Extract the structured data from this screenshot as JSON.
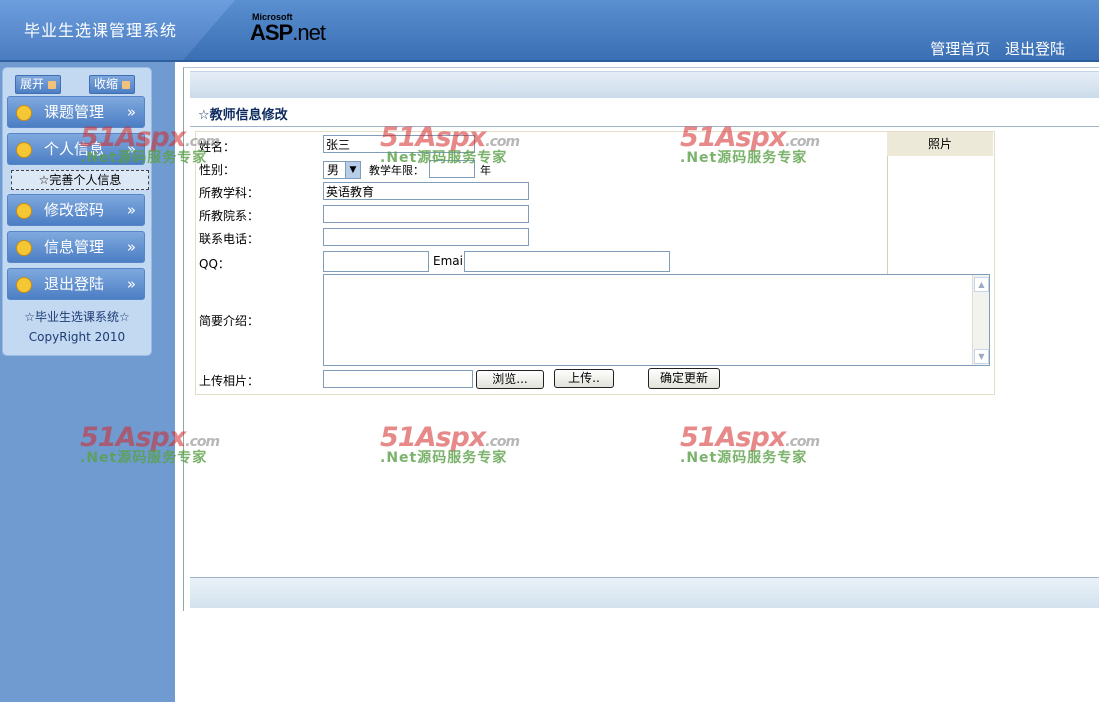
{
  "header": {
    "system_title": "毕业生选课管理系统",
    "logo_top": "Microsoft",
    "logo_main": "ASP",
    "logo_net": ".net",
    "links": [
      "管理首页",
      "退出登陆"
    ]
  },
  "sidebar": {
    "expand_label": "展开",
    "collapse_label": "收缩",
    "items": [
      {
        "label": "课题管理"
      },
      {
        "label": "个人信息"
      },
      {
        "label": "修改密码"
      },
      {
        "label": "信息管理"
      },
      {
        "label": "退出登陆"
      }
    ],
    "sub_item": "☆完善个人信息",
    "footer_title": "☆毕业生选课系统☆",
    "copyright": "CopyRight 2010"
  },
  "main": {
    "section_title": "☆教师信息修改"
  },
  "form": {
    "name_label": "姓名：",
    "name_value": "张三",
    "gender_label": "性别：",
    "gender_value": "男",
    "teach_years_label": "教学年限：",
    "teach_years_unit": "年",
    "subject_label": "所教学科：",
    "subject_value": "英语教育",
    "dept_label": "所教院系：",
    "phone_label": "联系电话：",
    "qq_label": "QQ：",
    "email_label": "Email:",
    "intro_label": "简要介绍：",
    "upload_label": "上传相片：",
    "photo_label": "照片",
    "browse_button": "浏览...",
    "upload_button": "上传..",
    "submit_button": "确定更新"
  },
  "watermark": {
    "brand_main": "51Aspx",
    "brand_domain": ".com",
    "slogan": ".Net源码服务专家"
  },
  "colors": {
    "header_blue": "#3a6fb4",
    "sidebar_blue": "#6f9bd1",
    "watermark_red": "#d42a2a",
    "watermark_green": "#5aa047"
  }
}
